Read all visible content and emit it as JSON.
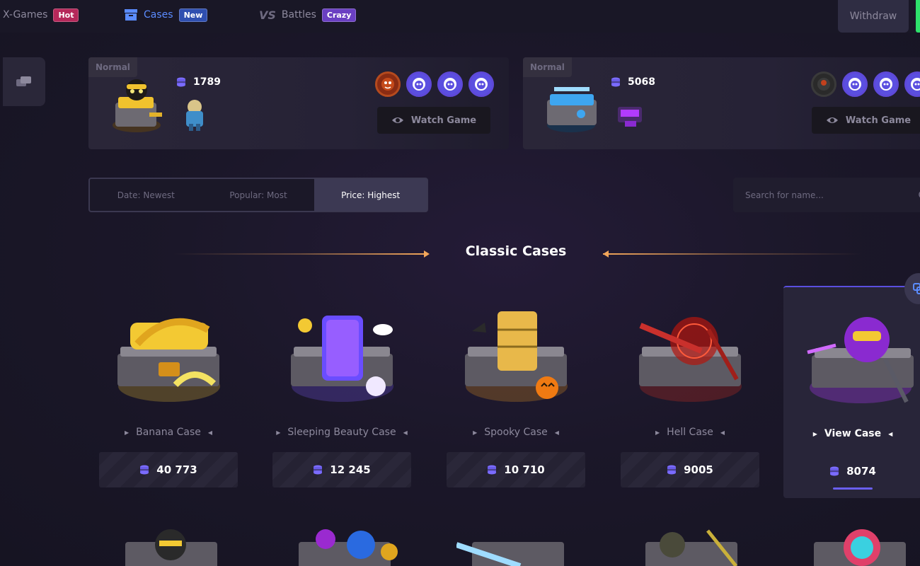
{
  "nav": {
    "xgames": {
      "label": "X-Games",
      "badge": "Hot"
    },
    "cases": {
      "label": "Cases",
      "badge": "New"
    },
    "battles": {
      "prefix": "VS",
      "label": "Battles",
      "badge": "Crazy"
    },
    "withdraw_label": "Withdraw"
  },
  "battles": [
    {
      "mode": "Normal",
      "coins": "1789",
      "watch_label": "Watch Game"
    },
    {
      "mode": "Normal",
      "coins": "5068",
      "watch_label": "Watch Game"
    }
  ],
  "sort": {
    "tabs": [
      "Date: Newest",
      "Popular: Most",
      "Price: Highest"
    ],
    "active": "Price: Highest"
  },
  "search": {
    "placeholder": "Search for name..."
  },
  "section": {
    "title": "Classic Cases"
  },
  "cases": [
    {
      "name": "Banana Case",
      "price": "40 773",
      "color": "#f3c933"
    },
    {
      "name": "Sleeping Beauty Case",
      "price": "12 245",
      "color": "#7c5bff"
    },
    {
      "name": "Spooky Case",
      "price": "10 710",
      "color": "#f39a1f"
    },
    {
      "name": "Hell Case",
      "price": "9005",
      "color": "#e2301f"
    },
    {
      "name": "View Case",
      "price": "8074",
      "color": "#b23bff"
    }
  ],
  "colors": {
    "accent": "#5b8cff",
    "coin": "#7b6cff",
    "arrow": "#f2a65a",
    "online": "#2ee06b"
  }
}
